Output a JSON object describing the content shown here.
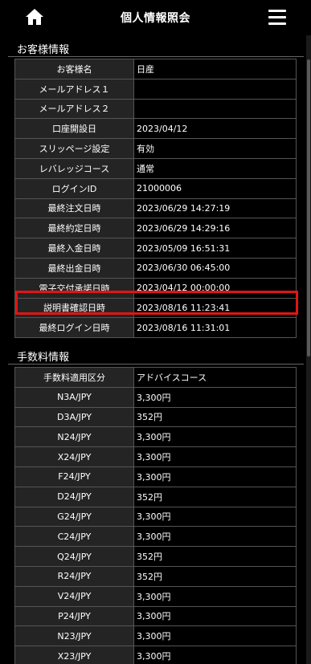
{
  "header": {
    "title": "個人情報照会",
    "home_icon": "home-icon",
    "menu_icon": "hamburger-menu-icon"
  },
  "customer_section": {
    "title": "お客様情報",
    "rows": [
      {
        "label": "お客様名",
        "value": "日産"
      },
      {
        "label": "メールアドレス１",
        "value": ""
      },
      {
        "label": "メールアドレス２",
        "value": ""
      },
      {
        "label": "口座開設日",
        "value": "2023/04/12"
      },
      {
        "label": "スリッページ設定",
        "value": "有効"
      },
      {
        "label": "レバレッジコース",
        "value": "通常"
      },
      {
        "label": "ログインID",
        "value": "21000006"
      },
      {
        "label": "最終注文日時",
        "value": "2023/06/29 14:27:19"
      },
      {
        "label": "最終約定日時",
        "value": "2023/06/29 14:29:16"
      },
      {
        "label": "最終入金日時",
        "value": "2023/05/09 16:51:31"
      },
      {
        "label": "最終出金日時",
        "value": "2023/06/30 06:45:00"
      },
      {
        "label": "電子交付承諾日時",
        "value": "2023/04/12 00:00:00"
      },
      {
        "label": "説明書確認日時",
        "value": "2023/08/16 11:23:41"
      },
      {
        "label": "最終ログイン日時",
        "value": "2023/08/16 11:31:01"
      }
    ]
  },
  "fee_section": {
    "title": "手数料情報",
    "rows": [
      {
        "label": "手数料適用区分",
        "value": "アドバイスコース"
      },
      {
        "label": "N3A/JPY",
        "value": "3,300円"
      },
      {
        "label": "D3A/JPY",
        "value": "352円"
      },
      {
        "label": "N24/JPY",
        "value": "3,300円"
      },
      {
        "label": "X24/JPY",
        "value": "3,300円"
      },
      {
        "label": "F24/JPY",
        "value": "3,300円"
      },
      {
        "label": "D24/JPY",
        "value": "352円"
      },
      {
        "label": "G24/JPY",
        "value": "3,300円"
      },
      {
        "label": "C24/JPY",
        "value": "3,300円"
      },
      {
        "label": "Q24/JPY",
        "value": "352円"
      },
      {
        "label": "R24/JPY",
        "value": "352円"
      },
      {
        "label": "V24/JPY",
        "value": "3,300円"
      },
      {
        "label": "P24/JPY",
        "value": "3,300円"
      },
      {
        "label": "N23/JPY",
        "value": "3,300円"
      },
      {
        "label": "X23/JPY",
        "value": "3,300円"
      }
    ]
  },
  "highlight_color": "#e01515"
}
